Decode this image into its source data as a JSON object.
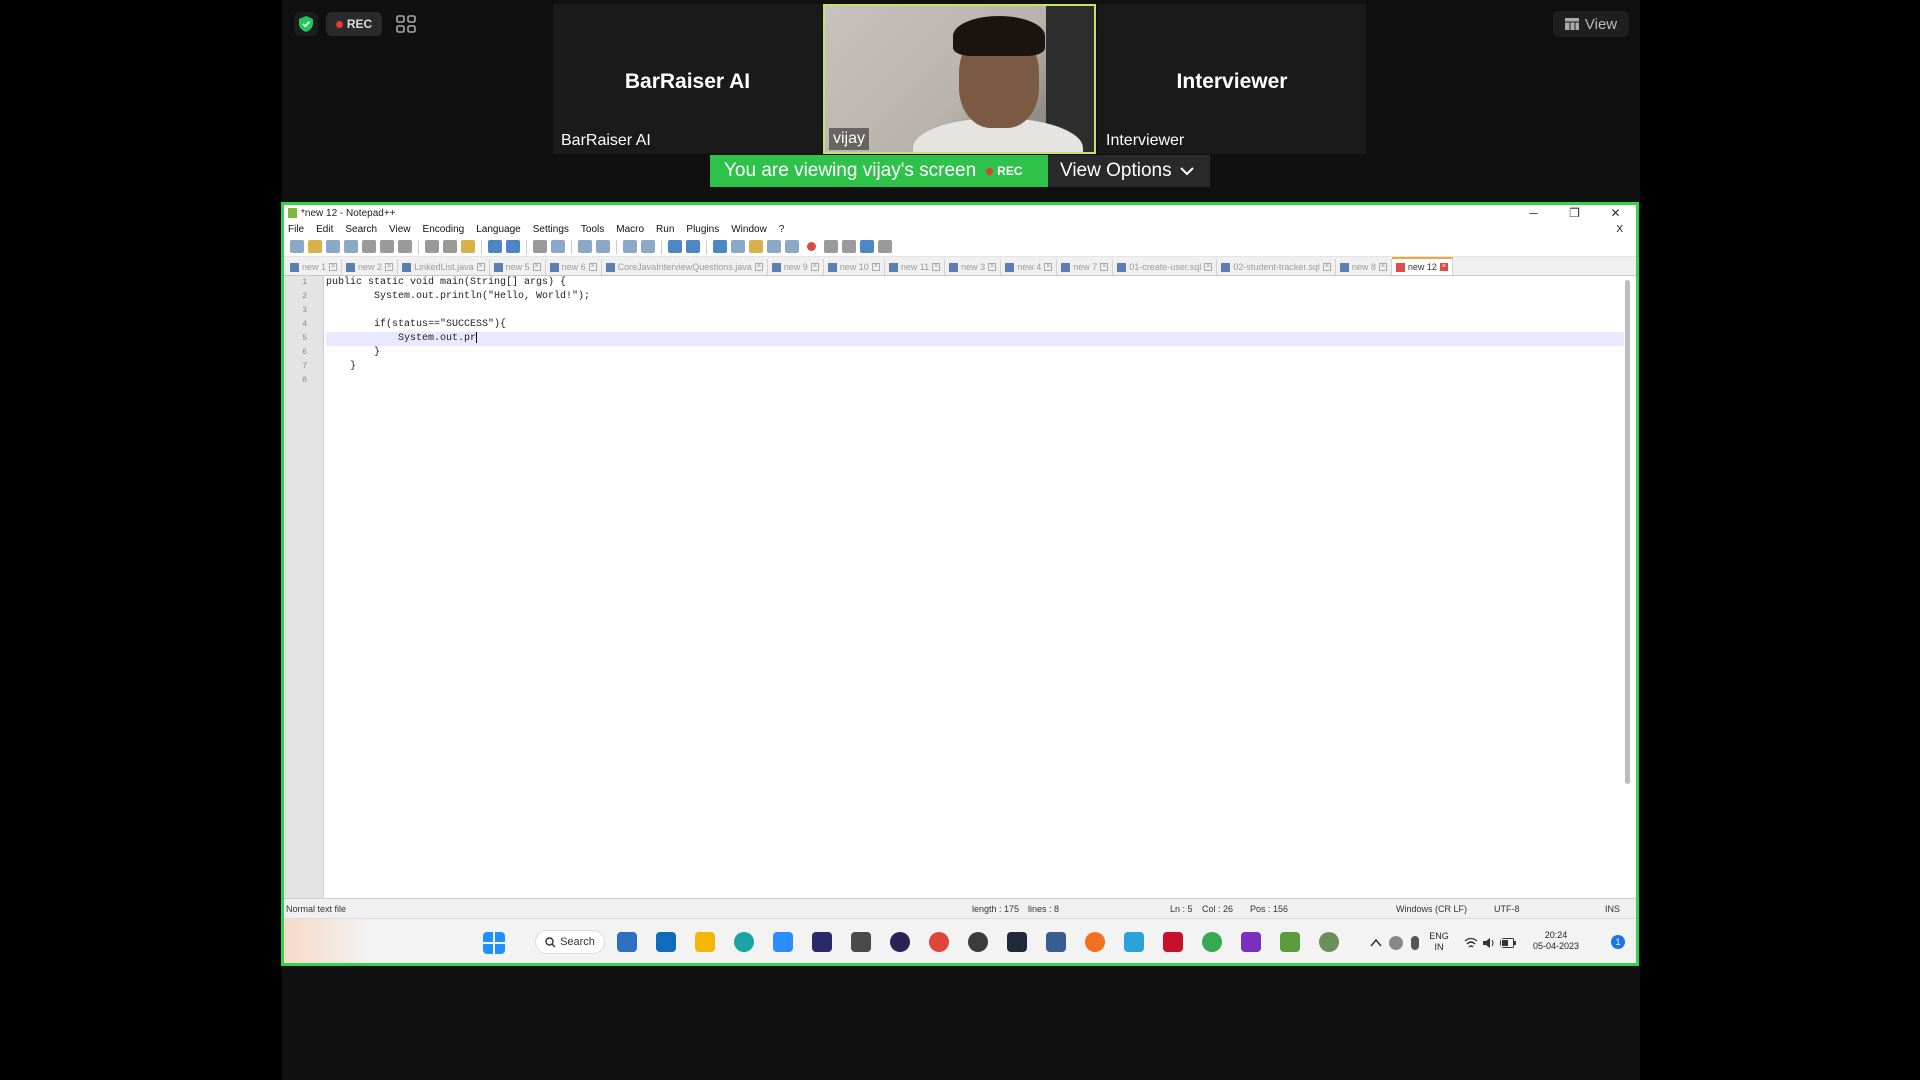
{
  "meeting": {
    "rec_label": "REC",
    "view_label": "View",
    "tiles": [
      {
        "name": "BarRaiser AI",
        "label": "BarRaiser AI"
      },
      {
        "name": "",
        "label": "vijay"
      },
      {
        "name": "Interviewer",
        "label": "Interviewer"
      }
    ],
    "banner_text": "You are viewing vijay's screen",
    "banner_rec": "REC",
    "view_options": "View Options",
    "accent_color": "#2fc24a"
  },
  "notepad": {
    "title": "*new 12 - Notepad++",
    "window_controls": [
      "─",
      "❐",
      "✕"
    ],
    "menu": [
      "File",
      "Edit",
      "Search",
      "View",
      "Encoding",
      "Language",
      "Settings",
      "Tools",
      "Macro",
      "Run",
      "Plugins",
      "Window",
      "?"
    ],
    "menu_close": "X",
    "tabs": [
      {
        "label": "new 1",
        "active": false
      },
      {
        "label": "new 2",
        "active": false
      },
      {
        "label": "LinkedList.java",
        "active": false
      },
      {
        "label": "new 5",
        "active": false
      },
      {
        "label": "new 6",
        "active": false
      },
      {
        "label": "CoreJavaInterviewQuestions.java",
        "active": false
      },
      {
        "label": "new 9",
        "active": false
      },
      {
        "label": "new 10",
        "active": false
      },
      {
        "label": "new 11",
        "active": false
      },
      {
        "label": "new 3",
        "active": false
      },
      {
        "label": "new 4",
        "active": false
      },
      {
        "label": "new 7",
        "active": false
      },
      {
        "label": "01-create-user.sql",
        "active": false
      },
      {
        "label": "02-student-tracker.sql",
        "active": false
      },
      {
        "label": "new 8",
        "active": false
      },
      {
        "label": "new 12",
        "active": true
      }
    ],
    "lines": [
      {
        "num": "1",
        "text": "public static void main(String[] args) {"
      },
      {
        "num": "2",
        "text": "        System.out.println(\"Hello, World!\");"
      },
      {
        "num": "3",
        "text": ""
      },
      {
        "num": "4",
        "text": "        if(status==\"SUCCESS\"){"
      },
      {
        "num": "5",
        "text": "            System.out.pr"
      },
      {
        "num": "6",
        "text": "        }"
      },
      {
        "num": "7",
        "text": "    }"
      },
      {
        "num": "8",
        "text": ""
      }
    ],
    "current_line": 5,
    "status": {
      "file_type": "Normal text file",
      "length": "length : 175",
      "lines": "lines : 8",
      "ln": "Ln : 5",
      "col": "Col : 26",
      "pos": "Pos : 156",
      "eol": "Windows (CR LF)",
      "encoding": "UTF-8",
      "mode": "INS"
    }
  },
  "taskbar": {
    "search_label": "Search",
    "lang_top": "ENG",
    "lang_bottom": "IN",
    "time": "20:24",
    "date": "05-04-2023",
    "notification_count": "1"
  }
}
